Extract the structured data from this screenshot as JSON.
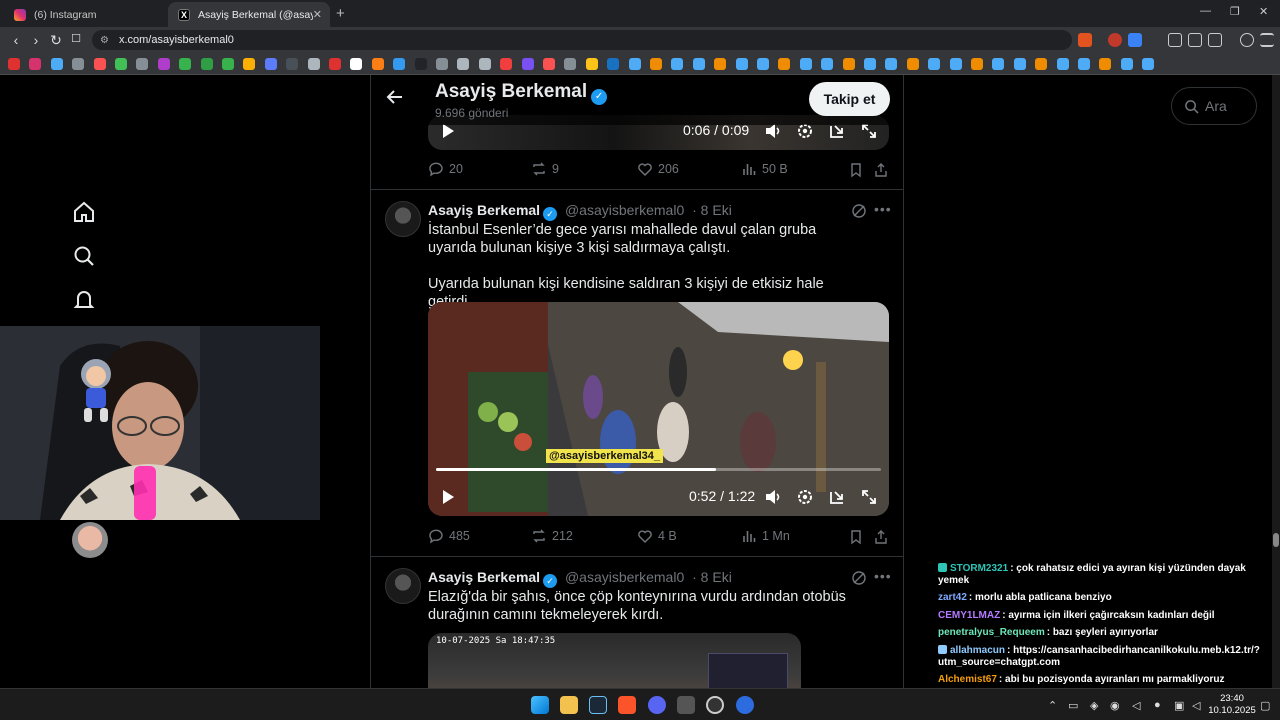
{
  "browser": {
    "tabs": [
      {
        "title": "(6) Instagram",
        "icon": "instagram-icon"
      },
      {
        "title": "Asayiş Berkemal (@asayisberkem",
        "icon": "x-icon"
      }
    ],
    "new_tab": "+",
    "url": "x.com/asayisberkemal0"
  },
  "profile_header": {
    "name": "Asayiş Berkemal",
    "post_count": "9.696 gönderi",
    "follow_label": "Takip et"
  },
  "search": {
    "placeholder": "Ara"
  },
  "top_video": {
    "time": "0:06 / 0:09"
  },
  "top_stats": {
    "replies": "20",
    "reposts": "9",
    "likes": "206",
    "views": "50 B"
  },
  "tweets": [
    {
      "name": "Asayiş Berkemal",
      "handle": "@asayisberkemal0",
      "date": "· 8 Eki",
      "text": "İstanbul Esenler’de gece yarısı mahallede davul çalan gruba uyarıda bulunan kişiye 3 kişi saldırmaya çalıştı.\n\nUyarıda bulunan kişi kendisine saldıran 3 kişiyi de etkisiz hale getirdi.",
      "video_watermark": "@asayisberkemal34_",
      "video_time": "0:52 / 1:22",
      "video_progress": 0.63,
      "stats": {
        "replies": "485",
        "reposts": "212",
        "likes": "4 B",
        "views": "1 Mn"
      }
    },
    {
      "name": "Asayiş Berkemal",
      "handle": "@asayisberkemal0",
      "date": "· 8 Eki",
      "text": "Elazığ'da bir şahıs, önce çöp konteynırına vurdu ardından otobüs durağının camını tekmeleyerek kırdı.",
      "video_timestamp": "10-07-2025 Sa 18:47:35"
    }
  ],
  "chat": [
    {
      "user": "STORM2321",
      "text": ": çok rahatsız edici ya ayıran kişi yüzünden dayak yemek",
      "color": "#2ec4b6",
      "badge": true
    },
    {
      "user": "zart42",
      "text": ": morlu abla patlicana benziyo",
      "color": "#7fa8ff",
      "badge": false
    },
    {
      "user": "CEMY1LMAZ",
      "text": ": ayırma için ilkeri çağırcaksın kadınları değil",
      "color": "#b57bff",
      "badge": false
    },
    {
      "user": "penetralyus_Requeem",
      "text": ": bazı şeyleri ayırıyorlar",
      "color": "#6ee7b7",
      "badge": false
    },
    {
      "user": "allahmacun",
      "text": ": https://cansanhacibedirhancanilkokulu.meb.k12.tr/?utm_source=chatgpt.com",
      "color": "#8ecbff",
      "badge": true
    },
    {
      "user": "Alchemist67",
      "text": ": abi bu pozisyonda ayıranları mı parmakliyoruz",
      "color": "#f59e0b",
      "badge": false
    }
  ],
  "clock": {
    "time": "23:40",
    "date": "10.10.2025"
  },
  "colors": {
    "accent": "#1d9bf0",
    "background": "#000000",
    "muted": "#71767b",
    "border": "#2f3336"
  }
}
